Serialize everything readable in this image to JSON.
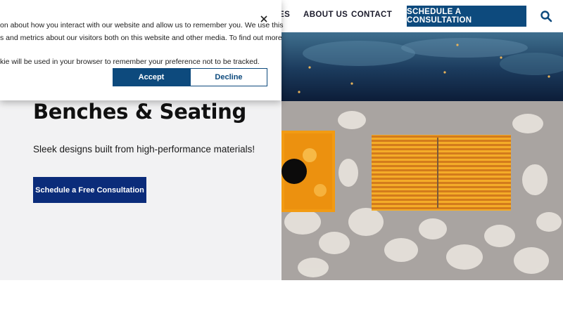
{
  "header": {
    "nav": [
      "ES",
      "ABOUT US",
      "CONTACT"
    ],
    "cta_label": "SCHEDULE A CONSULTATION",
    "search_icon": "search-icon"
  },
  "hero": {
    "title": "Benches & Seating",
    "subtitle": "Sleek designs built from high-performance materials!",
    "button_label": "Schedule a Free Consultation"
  },
  "cookie_banner": {
    "lines": [
      "on about how you interact with our website and allow us to remember you. We use this",
      "s and metrics about our visitors both on this website and other media. To find out more",
      "kie will be used in your browser to remember your preference not to be tracked."
    ],
    "accept_label": "Accept",
    "decline_label": "Decline",
    "close_icon": "close-icon"
  },
  "colors": {
    "brand_blue": "#0d4a7d",
    "hero_button": "#0b2c7a",
    "hero_bg": "#f2f2f3"
  }
}
